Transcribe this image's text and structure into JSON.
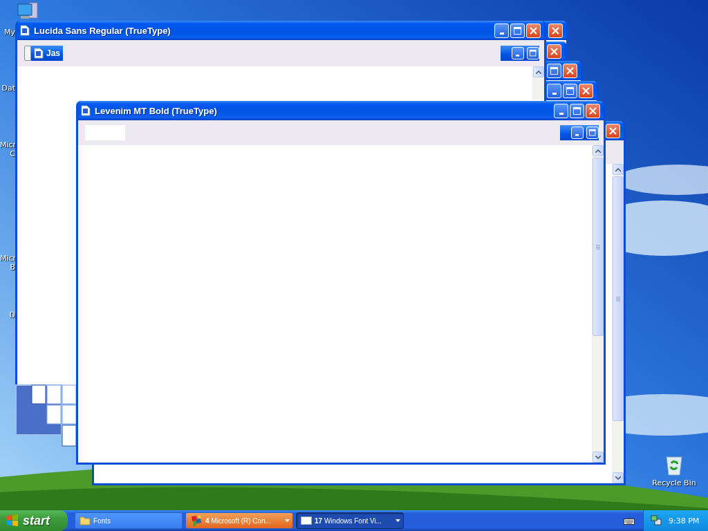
{
  "desktop": {
    "icons": [
      {
        "lines": [
          "My"
        ]
      },
      {
        "lines": [
          "Dat"
        ]
      },
      {
        "lines": [
          "Micr",
          "C"
        ]
      },
      {
        "lines": [
          "Micr",
          "B"
        ]
      },
      {
        "lines": [
          "D"
        ]
      }
    ],
    "recycle_bin": {
      "label": "Recycle Bin"
    }
  },
  "windows": [
    {
      "kind": "plain"
    },
    {
      "kind": "plain"
    },
    {
      "kind": "plain"
    },
    {
      "kind": "plain"
    },
    {
      "kind": "font",
      "title": "Lucida Sans Regular (TrueType)",
      "inner_title": "Jas"
    },
    {
      "kind": "plain"
    },
    {
      "kind": "font",
      "title": "Levenim MT Bold (TrueType)"
    }
  ],
  "taskbar": {
    "start": "start",
    "buttons": [
      {
        "kind": "folder",
        "label": "Fonts",
        "selected": false,
        "flashing": false
      },
      {
        "kind": "console",
        "count": "4",
        "label": "Microsoft (R) Con...",
        "selected": false,
        "flashing": true
      },
      {
        "kind": "window",
        "count": "17",
        "label": "Windows Font Vi...",
        "selected": true,
        "flashing": false
      }
    ],
    "clock": "9:38 PM"
  }
}
